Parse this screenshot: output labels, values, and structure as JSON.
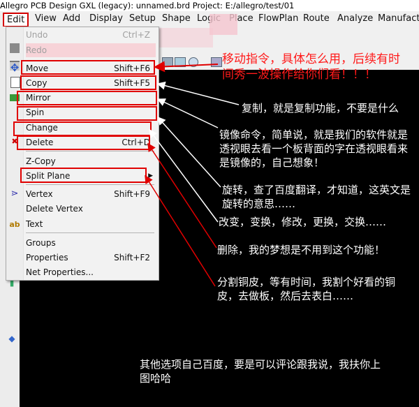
{
  "window": {
    "title": "Allegro PCB Design GXL (legacy): unnamed.brd  Project: E:/allegro/test/01"
  },
  "menubar": [
    "Edit",
    "View",
    "Add",
    "Display",
    "Setup",
    "Shape",
    "Logic",
    "Place",
    "FlowPlan",
    "Route",
    "Analyze",
    "Manufactu"
  ],
  "menu_items": [
    {
      "label": "Undo",
      "shortcut": "Ctrl+Z"
    },
    {
      "label": "Redo",
      "shortcut": ""
    },
    {
      "label": "Move",
      "shortcut": "Shift+F6"
    },
    {
      "label": "Copy",
      "shortcut": "Shift+F5"
    },
    {
      "label": "Mirror",
      "shortcut": ""
    },
    {
      "label": "Spin",
      "shortcut": ""
    },
    {
      "label": "Change",
      "shortcut": ""
    },
    {
      "label": "Delete",
      "shortcut": "Ctrl+D"
    },
    {
      "label": "Z-Copy",
      "shortcut": ""
    },
    {
      "label": "Split Plane",
      "shortcut": ""
    },
    {
      "label": "Vertex",
      "shortcut": "Shift+F9"
    },
    {
      "label": "Delete Vertex",
      "shortcut": ""
    },
    {
      "label": "Text",
      "shortcut": ""
    },
    {
      "label": "Groups",
      "shortcut": ""
    },
    {
      "label": "Properties",
      "shortcut": "Shift+F2"
    },
    {
      "label": "Net Properties...",
      "shortcut": ""
    }
  ],
  "annotations": {
    "move": "移动指令，具体怎么用，后续有时间秀一波操作给你们看！！！",
    "copy": "复制，就是复制功能，不要是什么",
    "mirror": "镜像命令，简单说，就是我们的软件就是透视眼去看一个板背面的字在透视眼看来是镜像的，自己想象！",
    "spin": "旋转，查了百度翻译，才知道，这英文是旋转的意思……",
    "change": "改变，变换，修改，更换，交换……",
    "delete": "删除，我的梦想是不用到这个功能！",
    "split": "分割铜皮，等有时间，我割个好看的铜皮，去做板，然后去表白……",
    "other": "其他选项自己百度，要是可以评论跟我说，我扶你上图哈哈"
  },
  "colors": {
    "highlight": "#e00000",
    "annotation_red": "#ff1a1a",
    "canvas": "#000000"
  }
}
